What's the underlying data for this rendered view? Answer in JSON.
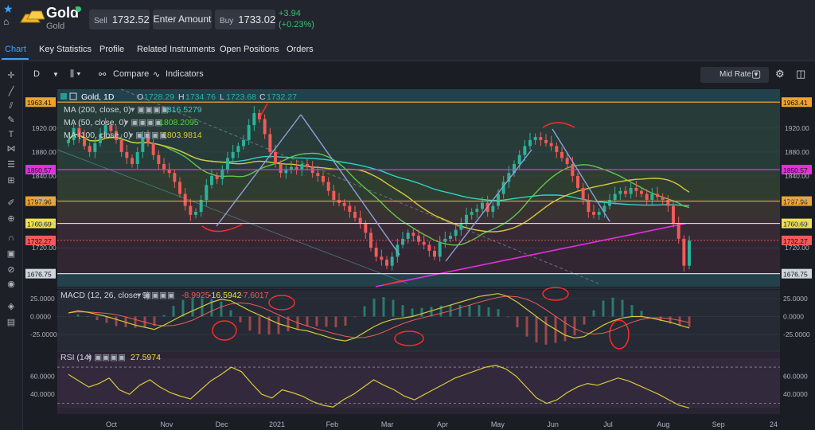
{
  "header": {
    "title": "Gold",
    "subtitle": "Gold",
    "sell_label": "Sell",
    "sell_price": "1732.52",
    "amount_placeholder": "Enter Amount",
    "buy_label": "Buy",
    "buy_price": "1733.02",
    "change_abs": "+3.94",
    "change_pct": "(+0.23%)"
  },
  "tabs": [
    "Chart",
    "Key Statistics",
    "Profile",
    "Related Instruments",
    "Open Positions",
    "Orders"
  ],
  "toolbar": {
    "interval": "D",
    "compare": "Compare",
    "indicators": "Indicators",
    "price_type": "Mid Rate"
  },
  "colors": {
    "accent": "#3ea2ff",
    "up": "#2bb39a",
    "down": "#f25a5a",
    "magenta": "#e62ee0",
    "orange": "#f0a32a",
    "yellow": "#f3e24a"
  },
  "chart_data": [
    {
      "type": "line",
      "instrument": "Gold, 1D",
      "ohlc": {
        "O": "1728.29",
        "H": "1734.76",
        "L": "1723.68",
        "C": "1732.27"
      },
      "ylim": [
        1655,
        1985
      ],
      "y_ticks": [
        1720,
        1760,
        1800,
        1840,
        1880,
        1920
      ],
      "y_tick_labels": [
        "1720.00",
        "1760.00",
        "1800.00",
        "1840.00",
        "1880.00",
        "1920.00"
      ],
      "x_tick_labels": [
        "Oct",
        "Nov",
        "Dec",
        "2021",
        "Feb",
        "Mar",
        "Apr",
        "May",
        "Jun",
        "Jul",
        "Aug",
        "Sep",
        "24"
      ],
      "levels": [
        {
          "value": 1963.41,
          "label": "1963.41",
          "color": "#f0a32a"
        },
        {
          "value": 1850.57,
          "label": "1850.57",
          "color": "#e62ee0"
        },
        {
          "value": 1797.96,
          "label": "1797.96",
          "color": "#f0a32a"
        },
        {
          "value": 1760.69,
          "label": "1760.69",
          "color": "#f3e24a"
        },
        {
          "value": 1732.27,
          "label": "1732.27",
          "color": "#f25a5a"
        },
        {
          "value": 1676.75,
          "label": "1676.75",
          "color": "#cfd6e0"
        }
      ],
      "moving_averages": [
        {
          "name": "MA (200, close, 0)",
          "value": "1816.5279",
          "color": "#2fd3c8"
        },
        {
          "name": "MA (50, close, 0)",
          "value": "1808.2095",
          "color": "#5fc94a"
        },
        {
          "name": "MA (100, close, 0)",
          "value": "1803.9814",
          "color": "#d8c93a"
        }
      ],
      "close_series": [
        1900,
        1920,
        1905,
        1890,
        1880,
        1895,
        1910,
        1925,
        1915,
        1900,
        1880,
        1870,
        1860,
        1880,
        1905,
        1895,
        1875,
        1860,
        1850,
        1845,
        1830,
        1810,
        1790,
        1775,
        1780,
        1800,
        1825,
        1840,
        1835,
        1850,
        1870,
        1880,
        1890,
        1900,
        1925,
        1945,
        1935,
        1910,
        1880,
        1860,
        1845,
        1850,
        1855,
        1850,
        1860,
        1855,
        1845,
        1840,
        1830,
        1815,
        1800,
        1795,
        1790,
        1780,
        1770,
        1760,
        1745,
        1720,
        1705,
        1700,
        1690,
        1705,
        1725,
        1735,
        1745,
        1740,
        1730,
        1725,
        1715,
        1705,
        1730,
        1735,
        1740,
        1750,
        1760,
        1775,
        1780,
        1785,
        1795,
        1780,
        1790,
        1810,
        1830,
        1845,
        1860,
        1875,
        1890,
        1900,
        1905,
        1900,
        1895,
        1890,
        1880,
        1870,
        1860,
        1840,
        1820,
        1800,
        1780,
        1775,
        1780,
        1790,
        1800,
        1810,
        1815,
        1810,
        1820,
        1815,
        1810,
        1800,
        1810,
        1805,
        1800,
        1790,
        1760,
        1735,
        1690,
        1732
      ]
    },
    {
      "type": "line",
      "name": "MACD (12, 26, close, 9)",
      "values_shown": [
        "-8.9925",
        "-16.5942",
        "-7.6017"
      ],
      "ylim": [
        -45,
        35
      ],
      "y_tick_labels": [
        "25.0000",
        "0.0000",
        "-25.0000"
      ],
      "macd_series": [
        5,
        8,
        6,
        3,
        0,
        -4,
        -8,
        -12,
        -15,
        -18,
        -12,
        -5,
        2,
        8,
        14,
        20,
        24,
        22,
        15,
        8,
        2,
        -4,
        -10,
        -14,
        -18,
        -20,
        -24,
        -28,
        -32,
        -34,
        -30,
        -22,
        -14,
        -8,
        -4,
        -2,
        0,
        4,
        8,
        12,
        16,
        20,
        24,
        28,
        30,
        32,
        28,
        20,
        10,
        0,
        -10,
        -18,
        -26,
        -30,
        -28,
        -20,
        -12,
        -6,
        -2,
        0,
        0,
        -2,
        -5,
        -8,
        -12,
        -16
      ]
    },
    {
      "type": "line",
      "name": "RSI (14)",
      "value_shown": "27.5974",
      "ylim": [
        20,
        85
      ],
      "y_tick_labels": [
        "60.0000",
        "40.0000"
      ],
      "rsi_series": [
        62,
        55,
        48,
        52,
        58,
        45,
        40,
        50,
        56,
        48,
        42,
        38,
        35,
        45,
        55,
        62,
        70,
        65,
        52,
        40,
        36,
        45,
        42,
        38,
        32,
        28,
        26,
        34,
        40,
        48,
        56,
        50,
        45,
        38,
        34,
        40,
        46,
        52,
        58,
        62,
        66,
        70,
        72,
        68,
        60,
        48,
        36,
        30,
        34,
        42,
        48,
        52,
        50,
        54,
        58,
        55,
        50,
        45,
        40,
        34,
        28,
        25
      ]
    }
  ]
}
